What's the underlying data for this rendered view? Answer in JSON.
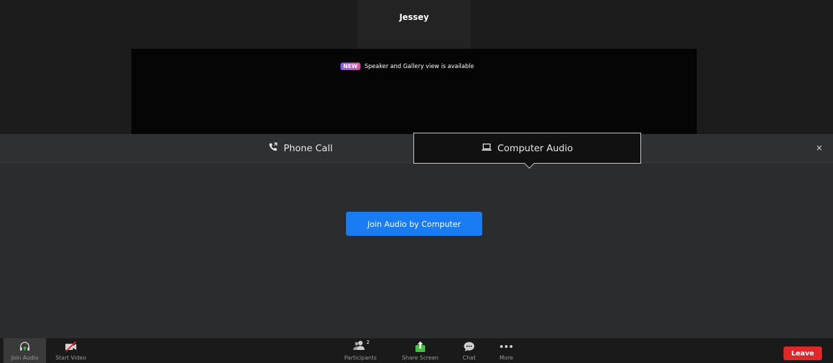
{
  "participant": {
    "name": "Jessey"
  },
  "banner": {
    "badge": "NEW",
    "text": "Speaker and Gallery view is available"
  },
  "audio_panel": {
    "tabs": [
      {
        "label": "Phone Call",
        "icon": "phone-icon",
        "selected": false
      },
      {
        "label": "Computer Audio",
        "icon": "laptop-icon",
        "selected": true
      }
    ],
    "close_label": "×",
    "join_button": "Join Audio by Computer"
  },
  "toolbar": {
    "join_audio": "Join Audio",
    "start_video": "Start Video",
    "participants": "Participants",
    "participants_count": "2",
    "share_screen": "Share Screen",
    "chat": "Chat",
    "more": "More",
    "leave": "Leave"
  },
  "colors": {
    "accent_blue": "#1a7cf2",
    "leave_red": "#e02828",
    "share_green": "#3fc53a"
  }
}
